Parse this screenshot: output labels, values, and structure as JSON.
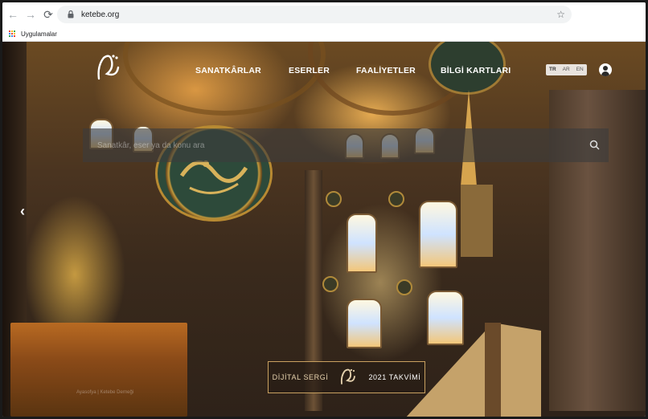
{
  "browser": {
    "url": "ketebe.org",
    "bookmarks_label": "Uygulamalar"
  },
  "nav": {
    "items": [
      "SANATKÂRLAR",
      "ESERLER",
      "FAALİYETLER",
      "BİLGİ KARTLARI"
    ],
    "languages": [
      "TR",
      "AR",
      "EN"
    ]
  },
  "search": {
    "placeholder": "Sanatkâr, eser ya da konu ara"
  },
  "banner": {
    "left_text": "DİJİTAL SERGİ",
    "right_text": "2021 TAKVİMİ"
  },
  "watermark": "Ayasofya | Ketebe Derneği",
  "colors": {
    "banner_border": "#c9a160",
    "medallion_green": "#2d4a3a",
    "gold": "#c49a3c"
  }
}
